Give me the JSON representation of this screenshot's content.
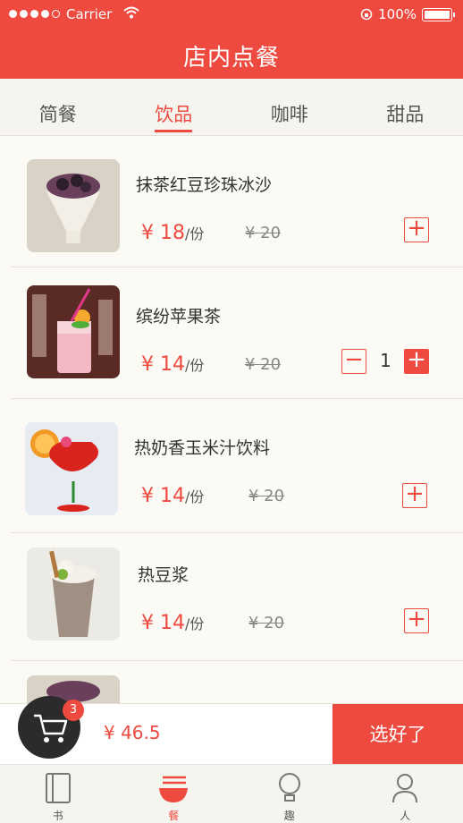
{
  "status": {
    "carrier": "Carrier",
    "battery": "100%"
  },
  "header": {
    "title": "店内点餐"
  },
  "tabs": [
    {
      "label": "简餐",
      "active": false
    },
    {
      "label": "饮品",
      "active": true
    },
    {
      "label": "咖啡",
      "active": false
    },
    {
      "label": "甜品",
      "active": false
    }
  ],
  "items": [
    {
      "name": "抹茶红豆珍珠冰沙",
      "price": "¥ 18",
      "unit": "/份",
      "old_price": "¥ 20",
      "qty": ""
    },
    {
      "name": "缤纷苹果茶",
      "price": "¥ 14",
      "unit": "/份",
      "old_price": "¥ 20",
      "qty": "1"
    },
    {
      "name": "热奶香玉米汁饮料",
      "price": "¥ 14",
      "unit": "/份",
      "old_price": "¥ 20",
      "qty": ""
    },
    {
      "name": "热豆浆",
      "price": "¥ 14",
      "unit": "/份",
      "old_price": "¥ 20",
      "qty": ""
    }
  ],
  "cart": {
    "count": "3",
    "total": "¥ 46.5",
    "checkout_label": "选好了"
  },
  "tabbar": [
    {
      "label": "书",
      "icon": "book-icon"
    },
    {
      "label": "餐",
      "icon": "noodle-bowl-icon"
    },
    {
      "label": "趣",
      "icon": "lightbulb-icon"
    },
    {
      "label": "人",
      "icon": "person-icon"
    }
  ],
  "colors": {
    "accent": "#ee4a3f",
    "background": "#fbfaf5",
    "dark": "#2b2b2b"
  }
}
